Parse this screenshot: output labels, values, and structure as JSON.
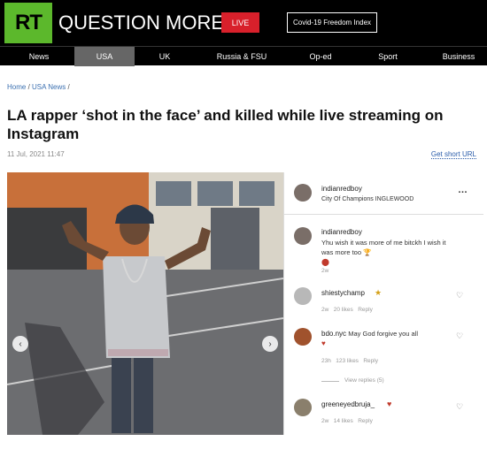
{
  "header": {
    "logo": "RT",
    "brand": "QUESTION MORE",
    "live_label": "LIVE",
    "covid_label": "Covid-19 Freedom Index"
  },
  "nav": {
    "items": [
      "News",
      "USA",
      "UK",
      "Russia & FSU",
      "Op-ed",
      "Sport",
      "Business"
    ],
    "active": "USA"
  },
  "article": {
    "breadcrumb_home": "Home",
    "breadcrumb_section": "USA News",
    "title": "LA rapper ‘shot in the face’ and killed while live streaming on Instagram",
    "date": "11 Jul, 2021 11:47",
    "short_url_label": "Get short URL"
  },
  "instagram": {
    "post_user": "indianredboy",
    "post_location": "City Of Champions INGLEWOOD",
    "comments": [
      {
        "user": "indianredboy",
        "text": "Yhu wish it was more of me bitckh I wish it was more too",
        "time": "2w"
      },
      {
        "user": "shiestychamp",
        "text": "",
        "time": "2w",
        "likes": "20 likes",
        "reply": "Reply"
      },
      {
        "user": "bdo.nyc",
        "text": "May God forgive you all",
        "time": "23h",
        "likes": "123 likes",
        "reply": "Reply",
        "view_replies": "View replies (5)"
      },
      {
        "user": "greeneyedbruja_",
        "text": "",
        "time": "2w",
        "likes": "14 likes",
        "reply": "Reply"
      }
    ]
  },
  "colors": {
    "brand_green": "#5cb82c",
    "live_red": "#d8202b",
    "link_blue": "#2a5caa"
  }
}
